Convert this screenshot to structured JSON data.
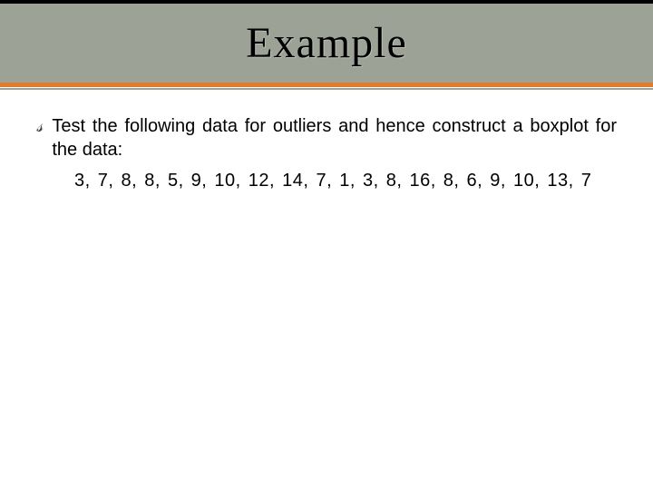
{
  "header": {
    "title": "Example"
  },
  "content": {
    "bullet_glyph": "༊",
    "intro": "Test the following data for outliers and hence construct a boxplot for the data:",
    "data_line": "3,  7,  8,  8,  5,  9,  10,  12,  14,  7,  1,  3,  8,  16,  8,  6,  9,  10,  13,  7"
  }
}
